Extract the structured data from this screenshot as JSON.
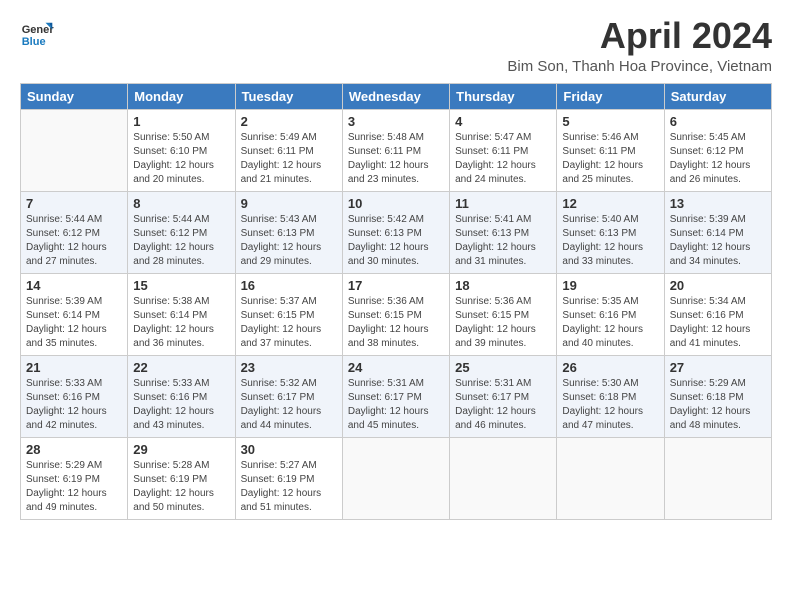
{
  "logo": {
    "text_general": "General",
    "text_blue": "Blue"
  },
  "header": {
    "title": "April 2024",
    "subtitle": "Bim Son, Thanh Hoa Province, Vietnam"
  },
  "weekdays": [
    "Sunday",
    "Monday",
    "Tuesday",
    "Wednesday",
    "Thursday",
    "Friday",
    "Saturday"
  ],
  "weeks": [
    [
      {
        "day": "",
        "sunrise": "",
        "sunset": "",
        "daylight": ""
      },
      {
        "day": "1",
        "sunrise": "Sunrise: 5:50 AM",
        "sunset": "Sunset: 6:10 PM",
        "daylight": "Daylight: 12 hours and 20 minutes."
      },
      {
        "day": "2",
        "sunrise": "Sunrise: 5:49 AM",
        "sunset": "Sunset: 6:11 PM",
        "daylight": "Daylight: 12 hours and 21 minutes."
      },
      {
        "day": "3",
        "sunrise": "Sunrise: 5:48 AM",
        "sunset": "Sunset: 6:11 PM",
        "daylight": "Daylight: 12 hours and 23 minutes."
      },
      {
        "day": "4",
        "sunrise": "Sunrise: 5:47 AM",
        "sunset": "Sunset: 6:11 PM",
        "daylight": "Daylight: 12 hours and 24 minutes."
      },
      {
        "day": "5",
        "sunrise": "Sunrise: 5:46 AM",
        "sunset": "Sunset: 6:11 PM",
        "daylight": "Daylight: 12 hours and 25 minutes."
      },
      {
        "day": "6",
        "sunrise": "Sunrise: 5:45 AM",
        "sunset": "Sunset: 6:12 PM",
        "daylight": "Daylight: 12 hours and 26 minutes."
      }
    ],
    [
      {
        "day": "7",
        "sunrise": "Sunrise: 5:44 AM",
        "sunset": "Sunset: 6:12 PM",
        "daylight": "Daylight: 12 hours and 27 minutes."
      },
      {
        "day": "8",
        "sunrise": "Sunrise: 5:44 AM",
        "sunset": "Sunset: 6:12 PM",
        "daylight": "Daylight: 12 hours and 28 minutes."
      },
      {
        "day": "9",
        "sunrise": "Sunrise: 5:43 AM",
        "sunset": "Sunset: 6:13 PM",
        "daylight": "Daylight: 12 hours and 29 minutes."
      },
      {
        "day": "10",
        "sunrise": "Sunrise: 5:42 AM",
        "sunset": "Sunset: 6:13 PM",
        "daylight": "Daylight: 12 hours and 30 minutes."
      },
      {
        "day": "11",
        "sunrise": "Sunrise: 5:41 AM",
        "sunset": "Sunset: 6:13 PM",
        "daylight": "Daylight: 12 hours and 31 minutes."
      },
      {
        "day": "12",
        "sunrise": "Sunrise: 5:40 AM",
        "sunset": "Sunset: 6:13 PM",
        "daylight": "Daylight: 12 hours and 33 minutes."
      },
      {
        "day": "13",
        "sunrise": "Sunrise: 5:39 AM",
        "sunset": "Sunset: 6:14 PM",
        "daylight": "Daylight: 12 hours and 34 minutes."
      }
    ],
    [
      {
        "day": "14",
        "sunrise": "Sunrise: 5:39 AM",
        "sunset": "Sunset: 6:14 PM",
        "daylight": "Daylight: 12 hours and 35 minutes."
      },
      {
        "day": "15",
        "sunrise": "Sunrise: 5:38 AM",
        "sunset": "Sunset: 6:14 PM",
        "daylight": "Daylight: 12 hours and 36 minutes."
      },
      {
        "day": "16",
        "sunrise": "Sunrise: 5:37 AM",
        "sunset": "Sunset: 6:15 PM",
        "daylight": "Daylight: 12 hours and 37 minutes."
      },
      {
        "day": "17",
        "sunrise": "Sunrise: 5:36 AM",
        "sunset": "Sunset: 6:15 PM",
        "daylight": "Daylight: 12 hours and 38 minutes."
      },
      {
        "day": "18",
        "sunrise": "Sunrise: 5:36 AM",
        "sunset": "Sunset: 6:15 PM",
        "daylight": "Daylight: 12 hours and 39 minutes."
      },
      {
        "day": "19",
        "sunrise": "Sunrise: 5:35 AM",
        "sunset": "Sunset: 6:16 PM",
        "daylight": "Daylight: 12 hours and 40 minutes."
      },
      {
        "day": "20",
        "sunrise": "Sunrise: 5:34 AM",
        "sunset": "Sunset: 6:16 PM",
        "daylight": "Daylight: 12 hours and 41 minutes."
      }
    ],
    [
      {
        "day": "21",
        "sunrise": "Sunrise: 5:33 AM",
        "sunset": "Sunset: 6:16 PM",
        "daylight": "Daylight: 12 hours and 42 minutes."
      },
      {
        "day": "22",
        "sunrise": "Sunrise: 5:33 AM",
        "sunset": "Sunset: 6:16 PM",
        "daylight": "Daylight: 12 hours and 43 minutes."
      },
      {
        "day": "23",
        "sunrise": "Sunrise: 5:32 AM",
        "sunset": "Sunset: 6:17 PM",
        "daylight": "Daylight: 12 hours and 44 minutes."
      },
      {
        "day": "24",
        "sunrise": "Sunrise: 5:31 AM",
        "sunset": "Sunset: 6:17 PM",
        "daylight": "Daylight: 12 hours and 45 minutes."
      },
      {
        "day": "25",
        "sunrise": "Sunrise: 5:31 AM",
        "sunset": "Sunset: 6:17 PM",
        "daylight": "Daylight: 12 hours and 46 minutes."
      },
      {
        "day": "26",
        "sunrise": "Sunrise: 5:30 AM",
        "sunset": "Sunset: 6:18 PM",
        "daylight": "Daylight: 12 hours and 47 minutes."
      },
      {
        "day": "27",
        "sunrise": "Sunrise: 5:29 AM",
        "sunset": "Sunset: 6:18 PM",
        "daylight": "Daylight: 12 hours and 48 minutes."
      }
    ],
    [
      {
        "day": "28",
        "sunrise": "Sunrise: 5:29 AM",
        "sunset": "Sunset: 6:19 PM",
        "daylight": "Daylight: 12 hours and 49 minutes."
      },
      {
        "day": "29",
        "sunrise": "Sunrise: 5:28 AM",
        "sunset": "Sunset: 6:19 PM",
        "daylight": "Daylight: 12 hours and 50 minutes."
      },
      {
        "day": "30",
        "sunrise": "Sunrise: 5:27 AM",
        "sunset": "Sunset: 6:19 PM",
        "daylight": "Daylight: 12 hours and 51 minutes."
      },
      {
        "day": "",
        "sunrise": "",
        "sunset": "",
        "daylight": ""
      },
      {
        "day": "",
        "sunrise": "",
        "sunset": "",
        "daylight": ""
      },
      {
        "day": "",
        "sunrise": "",
        "sunset": "",
        "daylight": ""
      },
      {
        "day": "",
        "sunrise": "",
        "sunset": "",
        "daylight": ""
      }
    ]
  ]
}
